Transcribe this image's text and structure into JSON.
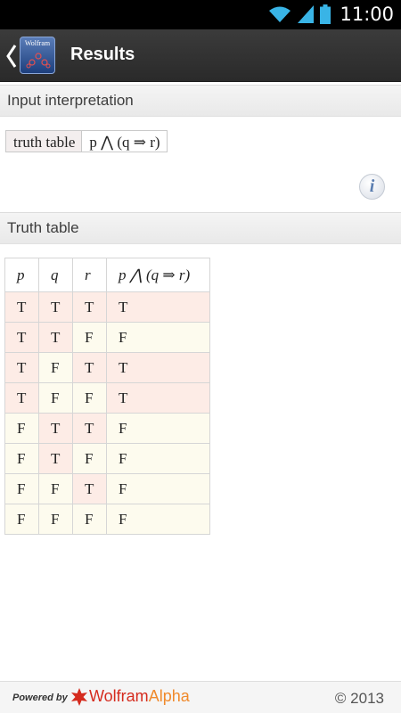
{
  "status_bar": {
    "time": "11:00",
    "wifi_icon": "wifi-icon",
    "signal_icon": "signal-icon",
    "battery_icon": "battery-icon"
  },
  "action_bar": {
    "title": "Results",
    "back_icon": "chevron-left-icon",
    "app_icon": "wolfram-app-icon",
    "app_icon_text": "Wolfram"
  },
  "pods": {
    "input": {
      "title": "Input interpretation",
      "cells": [
        "truth table",
        "p ⋀ (q ⇒ r)"
      ],
      "info_label": "i"
    },
    "truth_table": {
      "title": "Truth table",
      "headers": [
        "p",
        "q",
        "r",
        "p ⋀ (q ⇒ r)"
      ],
      "rows": [
        [
          "T",
          "T",
          "T",
          "T"
        ],
        [
          "T",
          "T",
          "F",
          "F"
        ],
        [
          "T",
          "F",
          "T",
          "T"
        ],
        [
          "T",
          "F",
          "F",
          "T"
        ],
        [
          "F",
          "T",
          "T",
          "F"
        ],
        [
          "F",
          "T",
          "F",
          "F"
        ],
        [
          "F",
          "F",
          "T",
          "F"
        ],
        [
          "F",
          "F",
          "F",
          "F"
        ]
      ]
    }
  },
  "footer": {
    "powered_by": "Powered by",
    "brand_wolfram": "Wolfram",
    "brand_alpha": "Alpha",
    "copyright": "© 2013"
  },
  "colors": {
    "true_cell": "#fdece6",
    "false_cell": "#fdfbee",
    "brand_red": "#d52b1e",
    "brand_orange": "#f08a2c"
  }
}
